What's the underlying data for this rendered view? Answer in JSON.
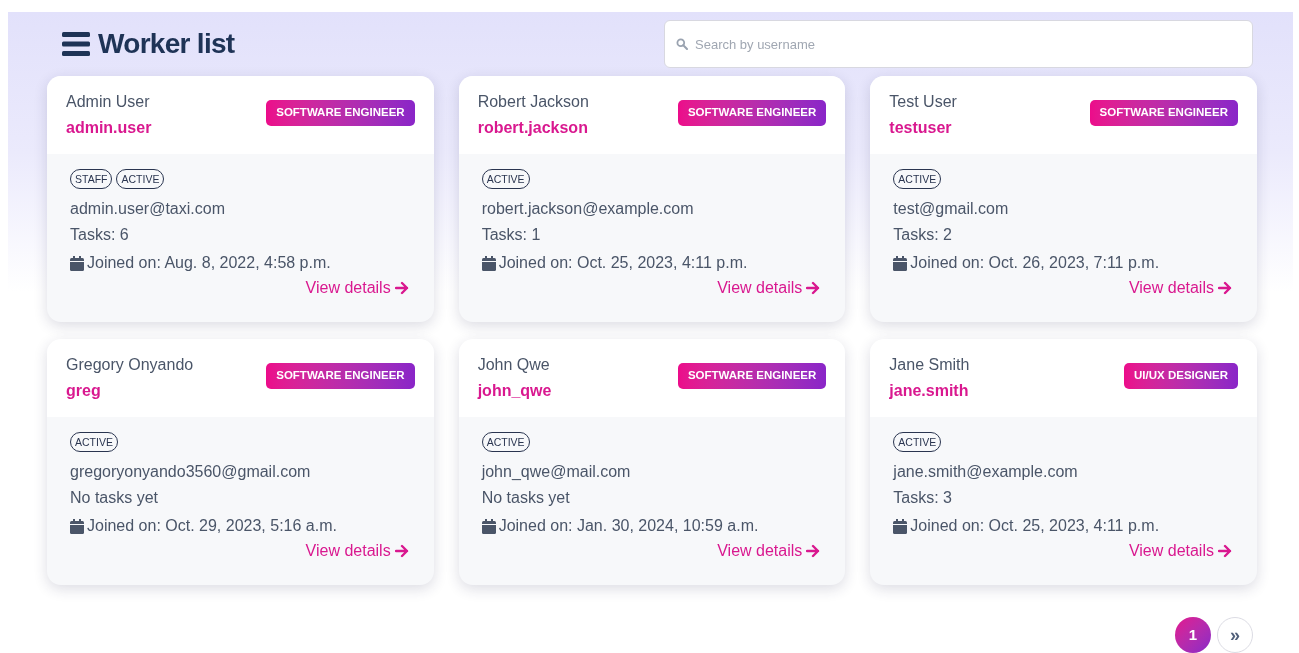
{
  "header": {
    "title": "Worker list"
  },
  "search": {
    "placeholder": "Search by username"
  },
  "workers": [
    {
      "name": "Admin User",
      "username": "admin.user",
      "position": "SOFTWARE ENGINEER",
      "tags": [
        "STAFF",
        "ACTIVE"
      ],
      "email": "admin.user@taxi.com",
      "tasks": "Tasks: 6",
      "joined": "Joined on: Aug. 8, 2022, 4:58 p.m.",
      "link": "View details"
    },
    {
      "name": "Robert Jackson",
      "username": "robert.jackson",
      "position": "SOFTWARE ENGINEER",
      "tags": [
        "ACTIVE"
      ],
      "email": "robert.jackson@example.com",
      "tasks": "Tasks: 1",
      "joined": "Joined on: Oct. 25, 2023, 4:11 p.m.",
      "link": "View details"
    },
    {
      "name": "Test User",
      "username": "testuser",
      "position": "SOFTWARE ENGINEER",
      "tags": [
        "ACTIVE"
      ],
      "email": "test@gmail.com",
      "tasks": "Tasks: 2",
      "joined": "Joined on: Oct. 26, 2023, 7:11 p.m.",
      "link": "View details"
    },
    {
      "name": "Gregory Onyando",
      "username": "greg",
      "position": "SOFTWARE ENGINEER",
      "tags": [
        "ACTIVE"
      ],
      "email": "gregoryonyando3560@gmail.com",
      "tasks": "No tasks yet",
      "joined": "Joined on: Oct. 29, 2023, 5:16 a.m.",
      "link": "View details"
    },
    {
      "name": "John Qwe",
      "username": "john_qwe",
      "position": "SOFTWARE ENGINEER",
      "tags": [
        "ACTIVE"
      ],
      "email": "john_qwe@mail.com",
      "tasks": "No tasks yet",
      "joined": "Joined on: Jan. 30, 2024, 10:59 a.m.",
      "link": "View details"
    },
    {
      "name": "Jane Smith",
      "username": "jane.smith",
      "position": "UI/UX DESIGNER",
      "tags": [
        "ACTIVE"
      ],
      "email": "jane.smith@example.com",
      "tasks": "Tasks: 3",
      "joined": "Joined on: Oct. 25, 2023, 4:11 p.m.",
      "link": "View details"
    }
  ],
  "pagination": [
    {
      "label": "1",
      "kind": "page",
      "selected": true
    },
    {
      "label": "»",
      "kind": "next",
      "selected": false
    }
  ]
}
